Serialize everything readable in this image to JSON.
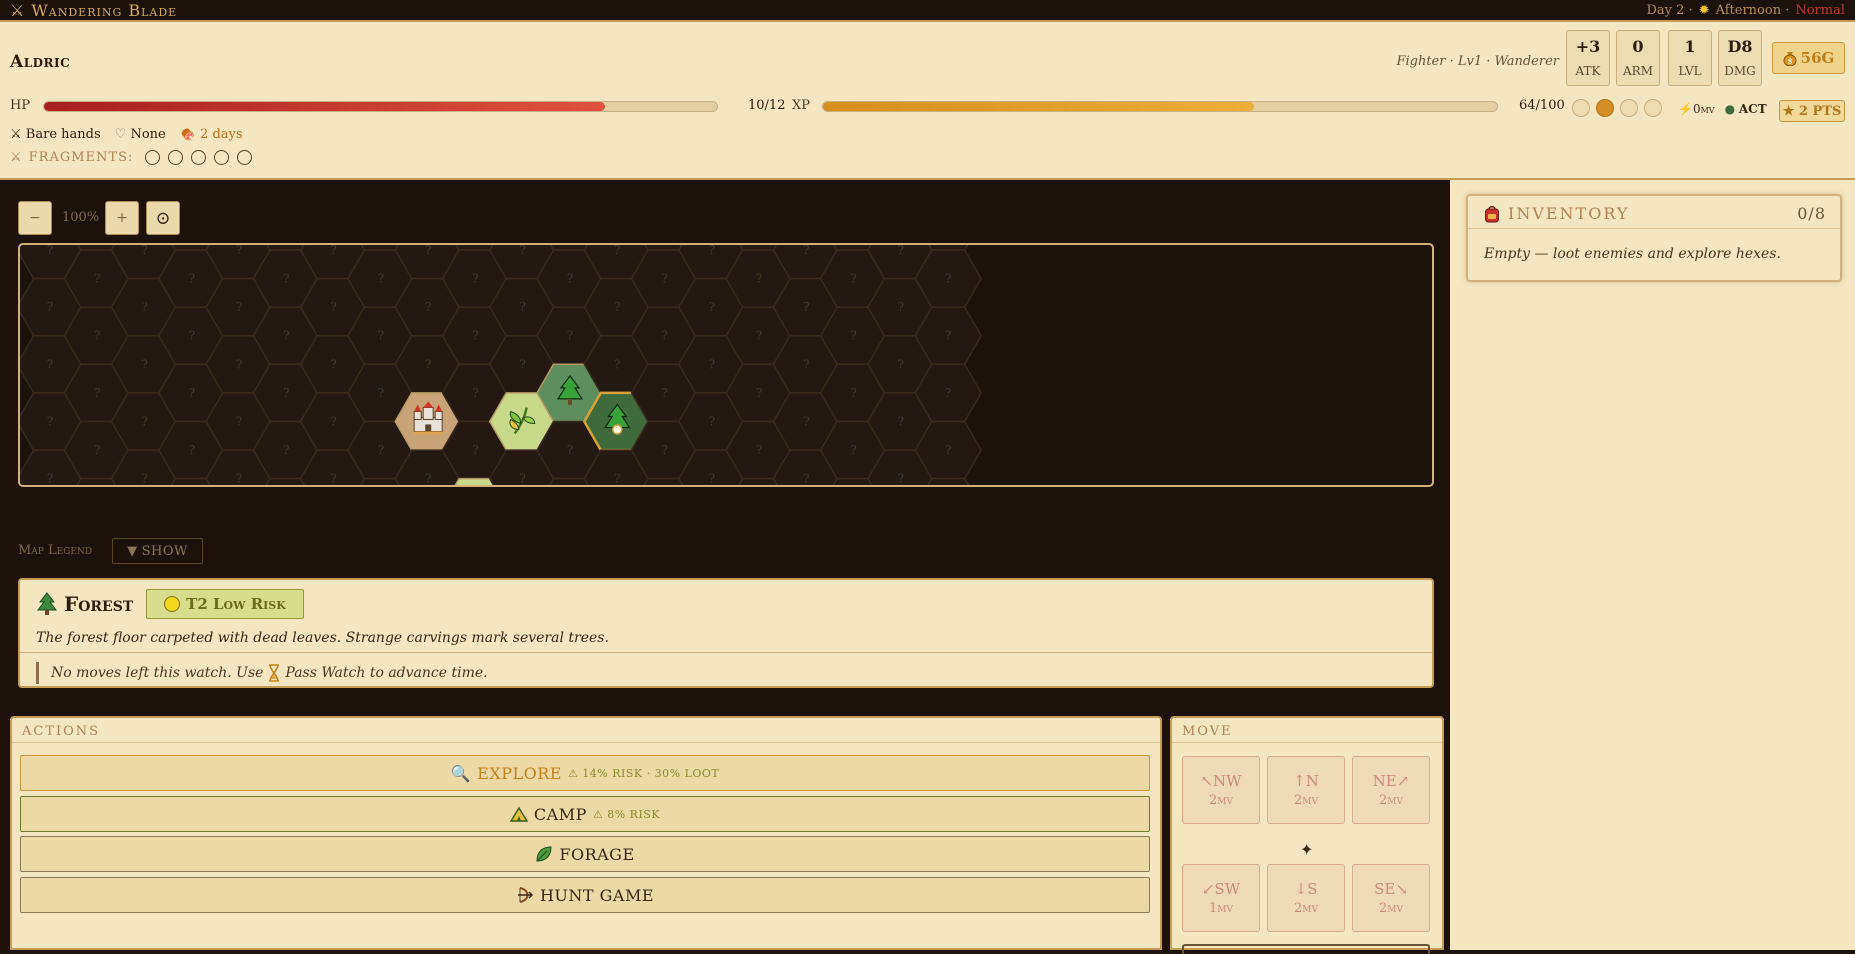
{
  "titlebar": {
    "app_title": "Wandering Blade",
    "day": "Day 2 ·",
    "period": "Afternoon ·",
    "mode": "Normal"
  },
  "character": {
    "name": "Aldric",
    "class_line": "Fighter · Lv1 · Wanderer",
    "stats": [
      {
        "value": "+3",
        "label": "ATK"
      },
      {
        "value": "0",
        "label": "ARM"
      },
      {
        "value": "1",
        "label": "LVL"
      },
      {
        "value": "D8",
        "label": "DMG"
      }
    ],
    "gold": "56G",
    "hp": {
      "label": "HP",
      "current": 10,
      "max": 12,
      "text": "10/12"
    },
    "xp": {
      "label": "XP",
      "current": 64,
      "max": 100,
      "text": "64/100"
    },
    "watch_dots": [
      false,
      true,
      false,
      false
    ],
    "mv": "0mv",
    "act": "ACT",
    "pts": "★ 2 PTS",
    "weapon": "Bare hands",
    "armor": "None",
    "food": "2 days",
    "fragments_label": "FRAGMENTS:",
    "fragments": [
      false,
      false,
      false,
      false,
      false
    ]
  },
  "map": {
    "zoom_out": "−",
    "zoom_level": "100%",
    "zoom_in": "+",
    "center": "⊙",
    "unknown_glyph": "?",
    "legend_label": "Map Legend",
    "legend_button": "SHOW",
    "legend_arrow": "▼",
    "colors": {
      "town": "#c8a478",
      "plains": "#c9d98c",
      "forest": "#5e8e5e",
      "forest_dark": "#3f6a3b",
      "fog": "#241912",
      "fog_edge": "#3a2a1b"
    }
  },
  "hex_info": {
    "terrain": "Forest",
    "risk_badge": "T2 Low Risk",
    "description": "The forest floor carpeted with dead leaves. Strange carvings mark several trees.",
    "watch_note_before": "No moves left this watch. Use",
    "watch_note_after": "Pass Watch to advance time."
  },
  "actions": {
    "header": "ACTIONS",
    "explore": {
      "label": "EXPLORE",
      "risk": "⚠ 14% RISK · 30% LOOT"
    },
    "camp": {
      "label": "CAMP",
      "risk": "⚠ 8% RISK"
    },
    "forage": {
      "label": "FORAGE"
    },
    "hunt": {
      "label": "HUNT GAME"
    }
  },
  "move": {
    "header": "MOVE",
    "nw": {
      "label": "↖NW",
      "cost": "2mv"
    },
    "n": {
      "label": "↑N",
      "cost": "2mv"
    },
    "ne": {
      "label": "NE↗",
      "cost": "2mv"
    },
    "sw": {
      "label": "↙SW",
      "cost": "1mv"
    },
    "s": {
      "label": "↓S",
      "cost": "2mv"
    },
    "se": {
      "label": "SE↘",
      "cost": "2mv"
    },
    "center": "✦"
  },
  "inventory": {
    "title": "INVENTORY",
    "count": "0/8",
    "empty_text": "Empty — loot enemies and explore hexes."
  }
}
